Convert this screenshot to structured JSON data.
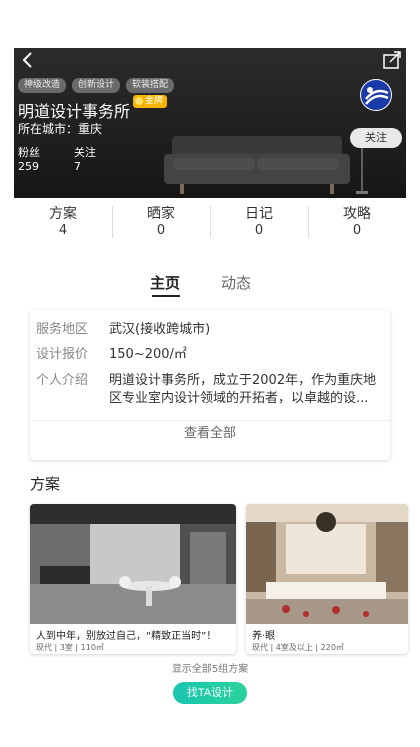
{
  "header": {
    "tags": [
      "神级改造",
      "创新设计",
      "软装搭配"
    ],
    "studio_name": "明道设计事务所",
    "badge": "金牌",
    "city": "所在城市：重庆",
    "fans_label": "粉丝",
    "fans_value": "259",
    "follow_label": "关注",
    "follow_value": "7",
    "follow_button": "关注"
  },
  "counts": [
    {
      "label": "方案",
      "value": "4"
    },
    {
      "label": "晒家",
      "value": "0"
    },
    {
      "label": "日记",
      "value": "0"
    },
    {
      "label": "攻略",
      "value": "0"
    }
  ],
  "tabs": [
    {
      "label": "主页",
      "active": true
    },
    {
      "label": "动态",
      "active": false
    }
  ],
  "info": {
    "service_label": "服务地区",
    "service_value": "武汉(接收跨城市)",
    "price_label": "设计报价",
    "price_value": "150~200/㎡",
    "intro_label": "个人介绍",
    "intro_value": "明道设计事务所，成立于2002年，作为重庆地区专业室内设计领域的开拓者，以卓越的设...",
    "view_all": "查看全部"
  },
  "projects_section": {
    "title": "方案",
    "items": [
      {
        "title": "人到中年，别放过自己，“精致正当时”！",
        "meta": "现代 | 3室 | 110㎡"
      },
      {
        "title": "养·眼",
        "meta": "现代 | 4室及以上 | 220㎡"
      }
    ],
    "show_all": "显示全部5组方案",
    "cta": "找TA设计"
  },
  "colors": {
    "accent": "#1fc9a8",
    "gold": "#f4b400",
    "hero_bg": "#222222"
  }
}
